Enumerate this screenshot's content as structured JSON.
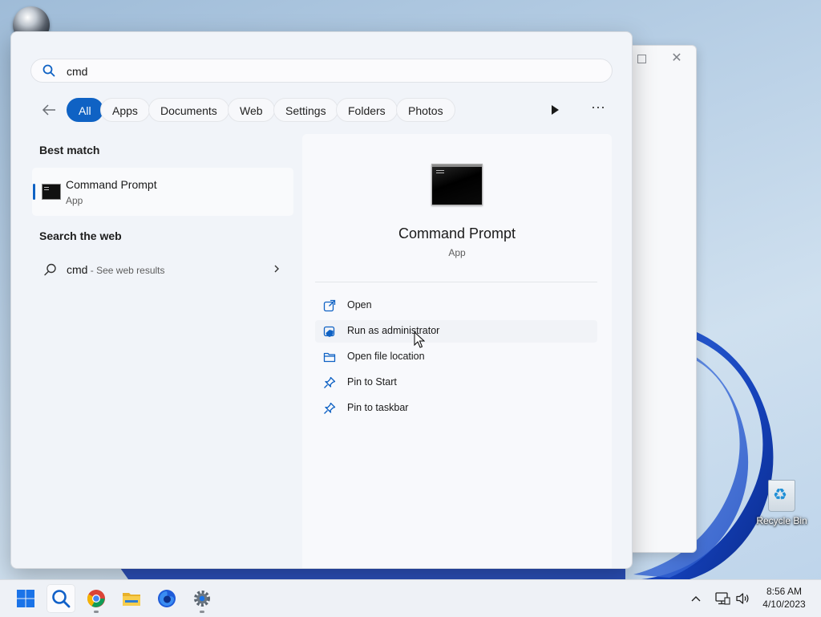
{
  "search": {
    "value": "cmd",
    "placeholder": ""
  },
  "filters": {
    "items": [
      {
        "label": "All",
        "active": true
      },
      {
        "label": "Apps",
        "active": false
      },
      {
        "label": "Documents",
        "active": false
      },
      {
        "label": "Web",
        "active": false
      },
      {
        "label": "Settings",
        "active": false
      },
      {
        "label": "Folders",
        "active": false
      },
      {
        "label": "Photos",
        "active": false
      }
    ]
  },
  "best_match": {
    "title": "Best match",
    "item": {
      "name": "Command Prompt",
      "type": "App",
      "icon": "command-prompt-icon"
    }
  },
  "search_web": {
    "title": "Search the web",
    "item": {
      "query": "cmd",
      "hint": " - See web results"
    }
  },
  "detail": {
    "name": "Command Prompt",
    "type": "App",
    "actions": [
      {
        "label": "Open",
        "icon": "open-external-icon"
      },
      {
        "label": "Run as administrator",
        "icon": "shield-icon"
      },
      {
        "label": "Open file location",
        "icon": "folder-icon"
      },
      {
        "label": "Pin to Start",
        "icon": "pin-icon"
      },
      {
        "label": "Pin to taskbar",
        "icon": "pin-icon"
      }
    ]
  },
  "desktop": {
    "recycle_bin_label": "Recycle Bin"
  },
  "taskbar": {
    "apps": [
      "windows-start-icon",
      "search-icon",
      "chrome-icon",
      "file-explorer-icon",
      "firefox-icon",
      "settings-gear-icon"
    ],
    "time": "8:56 AM",
    "date": "4/10/2023"
  },
  "colors": {
    "accent": "#0f62c4"
  }
}
